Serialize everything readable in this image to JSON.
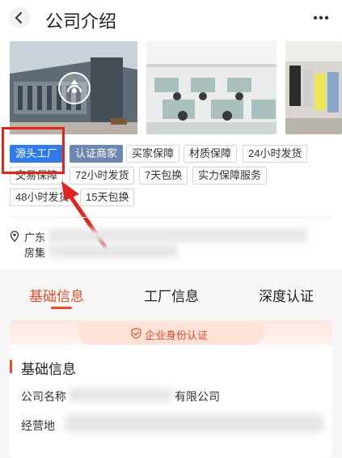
{
  "header": {
    "title": "公司介绍",
    "back_icon": "chevron-left-icon",
    "more_icon": "more-horizontal-icon"
  },
  "gallery": {
    "play_icon": "play-icon"
  },
  "tags": [
    "源头工厂",
    "认证商家",
    "买家保障",
    "材质保障",
    "24小时发货",
    "交易保障",
    "72小时发货",
    "7天包换",
    "实力保障服务",
    "48小时发货",
    "15天包换"
  ],
  "address": {
    "line1": "广东",
    "line2": "房集",
    "pin_icon": "location-pin-icon"
  },
  "tabs": [
    "基础信息",
    "工厂信息",
    "深度认证"
  ],
  "banner": {
    "text": "企业身份认证",
    "icon": "shield-check-icon"
  },
  "section": {
    "title": "基础信息",
    "rows": [
      {
        "label": "公司名称",
        "value": "有限公司"
      },
      {
        "label": "经营地"
      }
    ]
  },
  "colors": {
    "accent": "#e94b27",
    "highlight": "#e3231c",
    "tag_primary": "#2f7bea",
    "tag_verified": "#6d87b3"
  }
}
